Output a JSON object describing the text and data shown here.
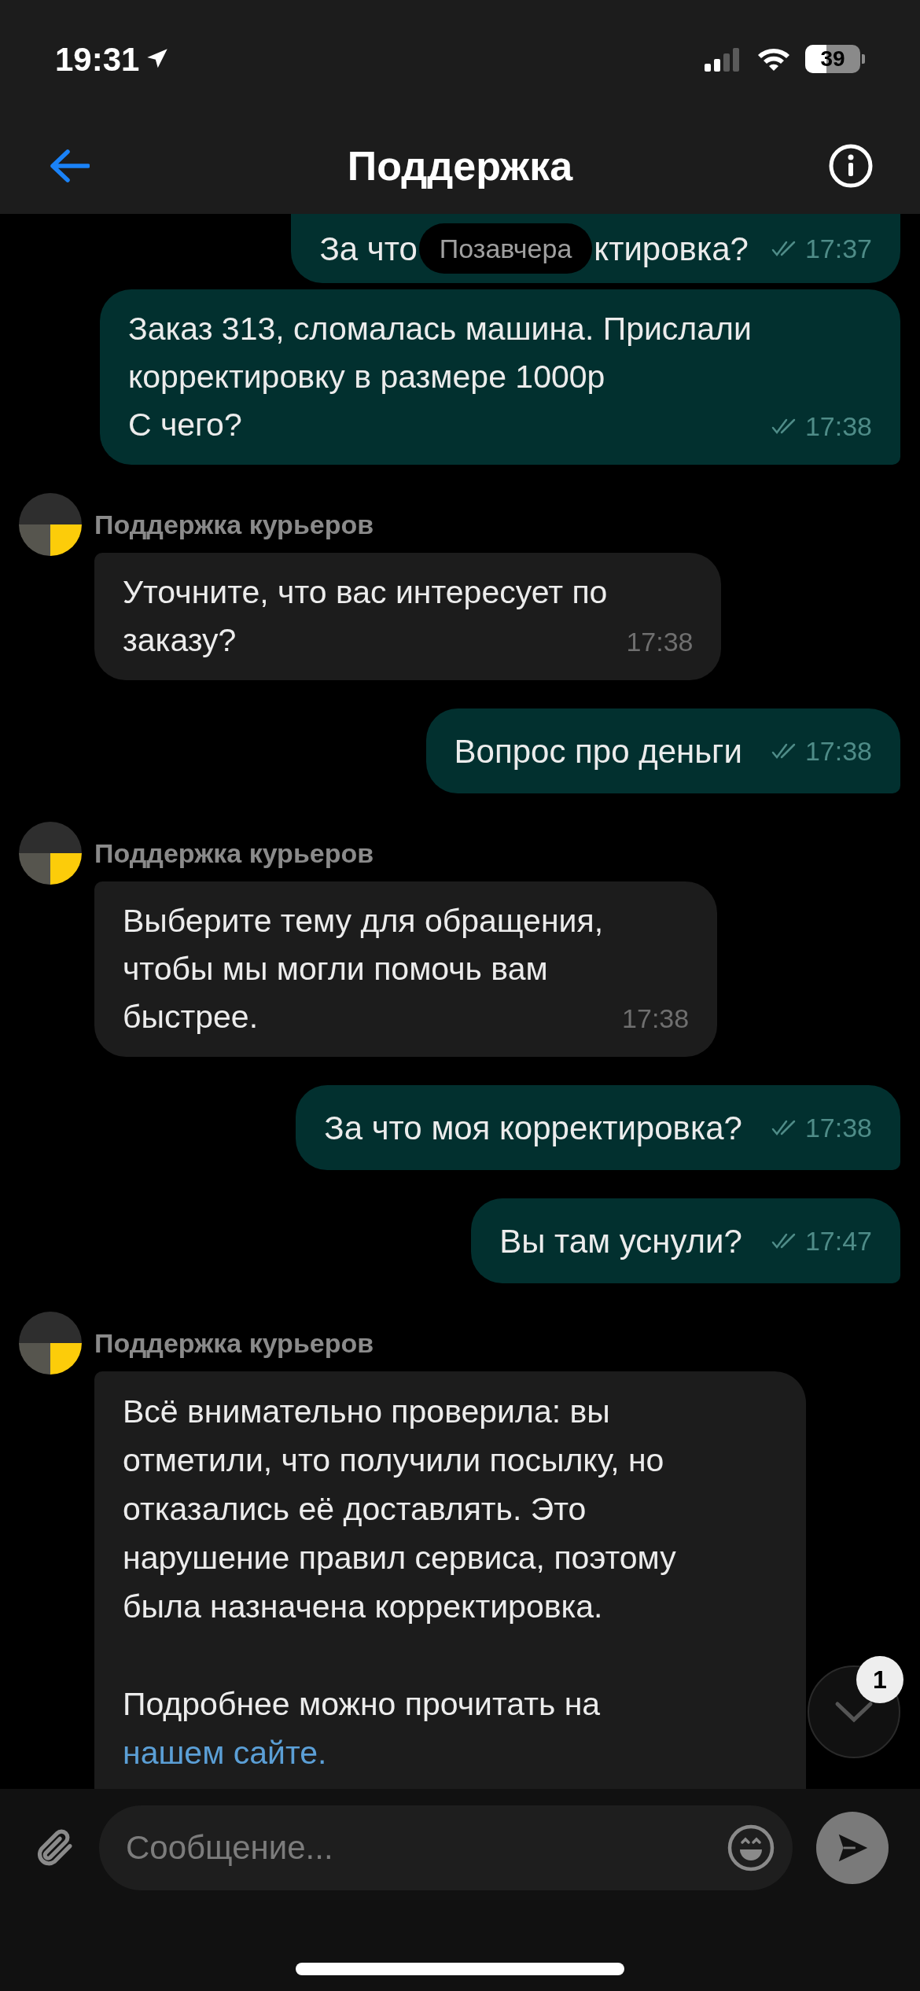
{
  "status_bar": {
    "time": "19:31",
    "battery": "39"
  },
  "header": {
    "title": "Поддержка"
  },
  "date_divider": "Позавчера",
  "messages": [
    {
      "kind": "outgoing",
      "parts": [
        "За что",
        "ктировка?"
      ],
      "time": "17:37",
      "read": true
    },
    {
      "kind": "outgoing",
      "lines": [
        "Заказ 313, сломалась машина. Прислали",
        "корректировку в размере 1000р",
        "С чего?"
      ],
      "time": "17:38",
      "read": true
    },
    {
      "kind": "incoming",
      "sender": "Поддержка курьеров",
      "lines": [
        "Уточните, что вас интересует по",
        "заказу?"
      ],
      "time": "17:38"
    },
    {
      "kind": "outgoing",
      "lines": [
        "Вопрос про деньги"
      ],
      "time": "17:38",
      "read": true
    },
    {
      "kind": "incoming",
      "sender": "Поддержка курьеров",
      "lines": [
        "Выберите тему для обращения,",
        "чтобы мы могли помочь вам",
        "быстрее."
      ],
      "time": "17:38"
    },
    {
      "kind": "outgoing",
      "lines": [
        "За что моя корректировка?"
      ],
      "time": "17:38",
      "read": true
    },
    {
      "kind": "outgoing",
      "lines": [
        "Вы там уснули?"
      ],
      "time": "17:47",
      "read": true
    },
    {
      "kind": "incoming",
      "sender": "Поддержка курьеров",
      "paragraphs": [
        {
          "lines": [
            "Всё внимательно проверила: вы",
            "отметили, что получили посылку, но",
            "отказались её доставлять. Это",
            "нарушение правил сервиса, поэтому",
            "была назначена корректировка."
          ]
        },
        {
          "lines": [
            "Подробнее можно прочитать на"
          ],
          "link": "нашем сайте."
        }
      ]
    }
  ],
  "scroll_button": {
    "badge": "1"
  },
  "composer": {
    "placeholder": "Сообщение..."
  }
}
